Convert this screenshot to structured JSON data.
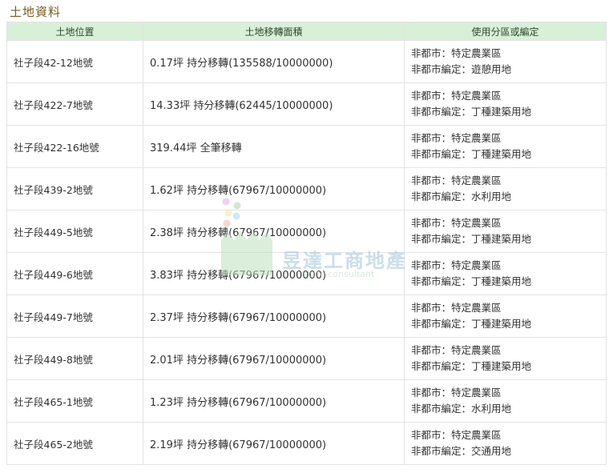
{
  "section_title": "土地資料",
  "columns": [
    "土地位置",
    "土地移轉面積",
    "使用分區或編定"
  ],
  "rows": [
    {
      "location": "社子段42-12地號",
      "area": "0.17坪 持分移轉(135588/10000000)",
      "zone1": "非都市：特定農業區",
      "zone2": "非都市編定：遊憩用地"
    },
    {
      "location": "社子段422-7地號",
      "area": "14.33坪 持分移轉(62445/10000000)",
      "zone1": "非都市：特定農業區",
      "zone2": "非都市編定：丁種建築用地"
    },
    {
      "location": "社子段422-16地號",
      "area": "319.44坪 全筆移轉",
      "zone1": "非都市：特定農業區",
      "zone2": "非都市編定：丁種建築用地"
    },
    {
      "location": "社子段439-2地號",
      "area": "1.62坪 持分移轉(67967/10000000)",
      "zone1": "非都市：特定農業區",
      "zone2": "非都市編定：水利用地"
    },
    {
      "location": "社子段449-5地號",
      "area": "2.38坪 持分移轉(67967/10000000)",
      "zone1": "非都市：特定農業區",
      "zone2": "非都市編定：丁種建築用地"
    },
    {
      "location": "社子段449-6地號",
      "area": "3.83坪 持分移轉(67967/10000000)",
      "zone1": "非都市：特定農業區",
      "zone2": "非都市編定：丁種建築用地"
    },
    {
      "location": "社子段449-7地號",
      "area": "2.37坪 持分移轉(67967/10000000)",
      "zone1": "非都市：特定農業區",
      "zone2": "非都市編定：丁種建築用地"
    },
    {
      "location": "社子段449-8地號",
      "area": "2.01坪 持分移轉(67967/10000000)",
      "zone1": "非都市：特定農業區",
      "zone2": "非都市編定：丁種建築用地"
    },
    {
      "location": "社子段465-1地號",
      "area": "1.23坪 持分移轉(67967/10000000)",
      "zone1": "非都市：特定農業區",
      "zone2": "非都市編定：水利用地"
    },
    {
      "location": "社子段465-2地號",
      "area": "2.19坪 持分移轉(67967/10000000)",
      "zone1": "非都市：特定農業區",
      "zone2": "非都市編定：交通用地"
    }
  ],
  "watermark": {
    "name": "昱達工商地產",
    "sub": "state consultant"
  }
}
